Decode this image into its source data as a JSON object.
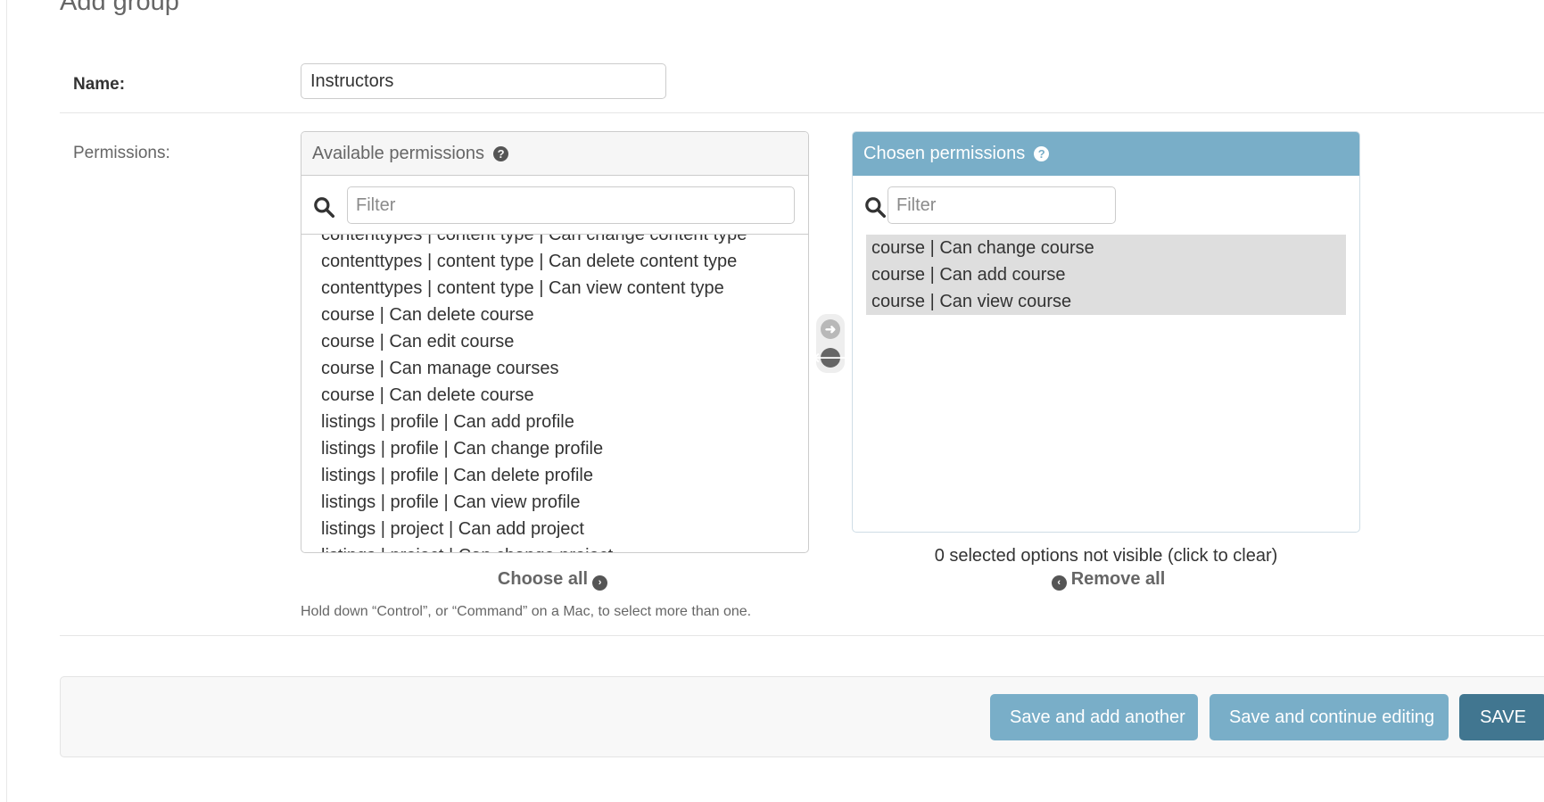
{
  "page": {
    "title": "Add group"
  },
  "name_field": {
    "label": "Name:",
    "value": "Instructors"
  },
  "permissions_field": {
    "label": "Permissions:"
  },
  "available": {
    "title": "Available permissions",
    "help_glyph": "?",
    "search_icon": "search-icon",
    "filter_placeholder": "Filter",
    "options": [
      "contenttypes | content type | Can change content type",
      "contenttypes | content type | Can delete content type",
      "contenttypes | content type | Can view content type",
      "course | Can delete course",
      "course | Can edit course",
      "course | Can manage courses",
      "course | Can delete course",
      "listings | profile | Can add profile",
      "listings | profile | Can change profile",
      "listings | profile | Can delete profile",
      "listings | profile | Can view profile",
      "listings | project | Can add project",
      "listings | project | Can change project"
    ],
    "choose_all_label": "Choose all"
  },
  "chosen": {
    "title": "Chosen permissions",
    "help_glyph": "?",
    "search_icon": "search-icon",
    "filter_placeholder": "Filter",
    "options": [
      "course | Can change course",
      "course | Can add course",
      "course | Can view course"
    ],
    "not_visible_text": "0 selected options not visible (click to clear)",
    "remove_all_label": "Remove all"
  },
  "transfer_arrows": {
    "add_icon": "arrow-right-circle-icon",
    "remove_icon": "arrow-left-circle-icon"
  },
  "help_text": "Hold down “Control”, or “Command” on a Mac, to select more than one.",
  "buttons": {
    "save_add_another": "Save and add another",
    "save_continue": "Save and continue editing",
    "save": "SAVE"
  },
  "colors": {
    "accent": "#79aec8",
    "primary": "#417690",
    "selected_option_bg": "#dedede"
  }
}
